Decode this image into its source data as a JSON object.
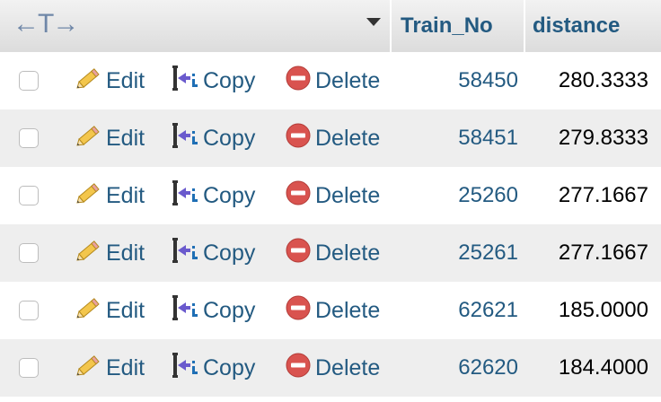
{
  "header": {
    "nav_arrows": "←T→",
    "columns": [
      {
        "label": "Train_No"
      },
      {
        "label": "distance"
      }
    ]
  },
  "actions": {
    "edit_label": "Edit",
    "copy_label": "Copy",
    "delete_label": "Delete"
  },
  "rows": [
    {
      "train_no": "58450",
      "distance": "280.3333"
    },
    {
      "train_no": "58451",
      "distance": "279.8333"
    },
    {
      "train_no": "25260",
      "distance": "277.1667"
    },
    {
      "train_no": "25261",
      "distance": "277.1667"
    },
    {
      "train_no": "62621",
      "distance": "185.0000"
    },
    {
      "train_no": "62620",
      "distance": "184.4000"
    }
  ],
  "colors": {
    "link": "#235a81",
    "header_bg": "#e5e5e5",
    "row_alt_bg": "#eeeeee",
    "delete_icon": "#d9534f"
  },
  "icons": [
    "pencil-icon",
    "copy-icon",
    "delete-icon",
    "sort-desc-icon"
  ]
}
